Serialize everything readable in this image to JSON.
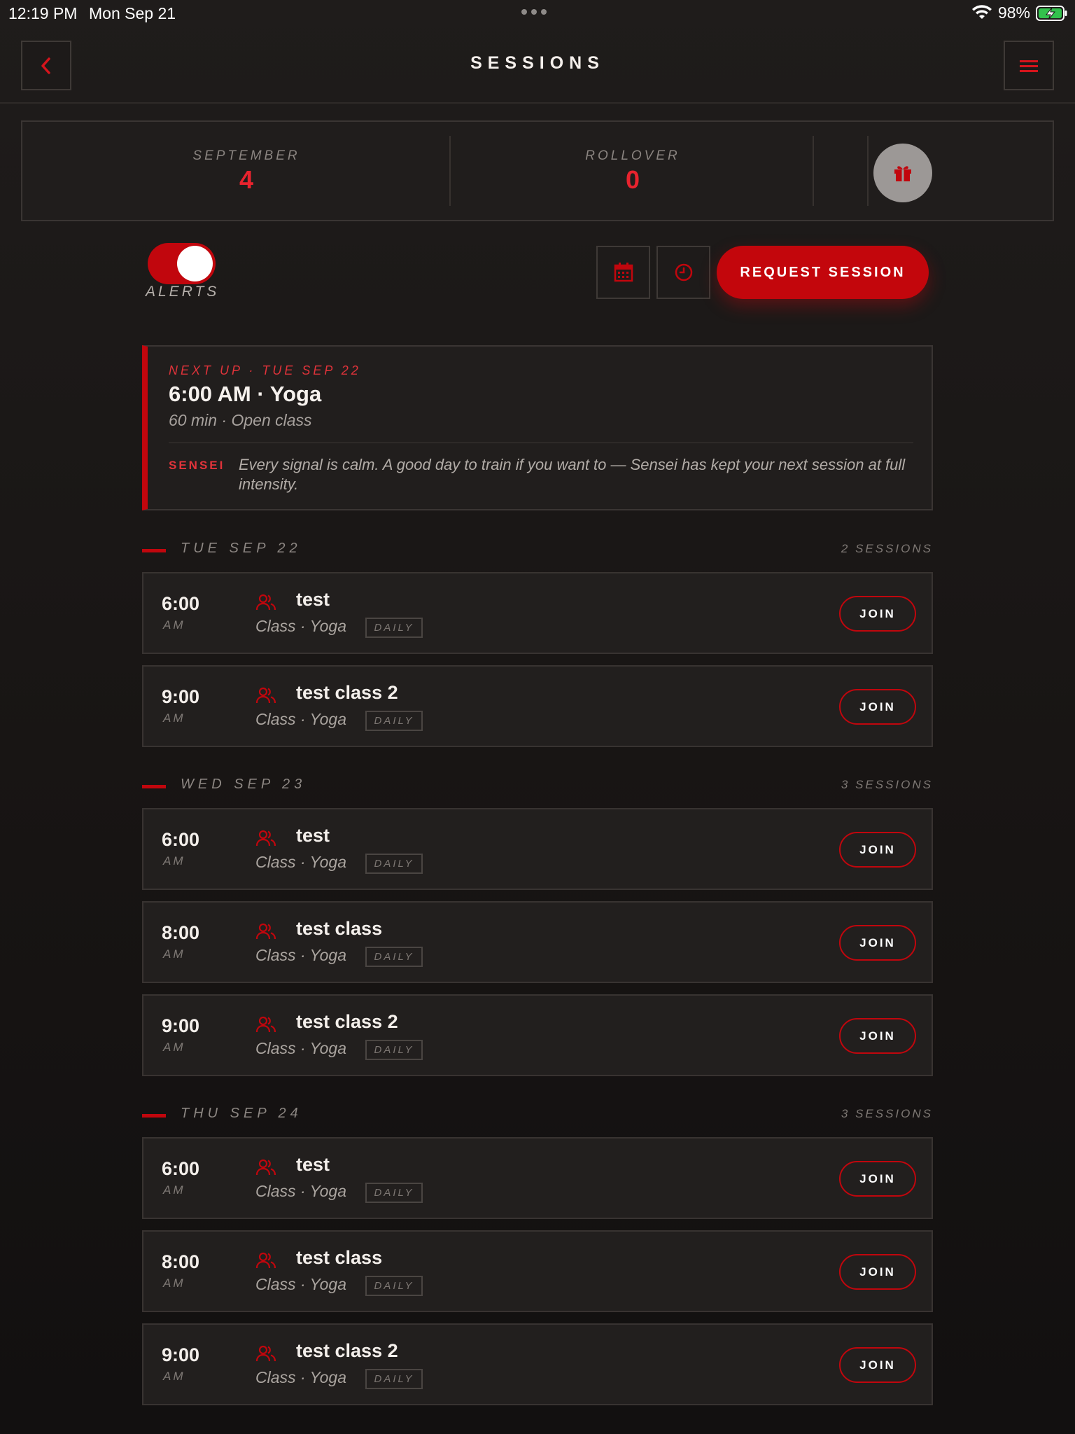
{
  "status_bar": {
    "time": "12:19 PM",
    "date": "Mon Sep 21",
    "battery": "98%"
  },
  "header": {
    "title": "SESSIONS",
    "back_icon": "chevron-left-icon",
    "menu_icon": "hamburger-menu-icon"
  },
  "stats": {
    "month_label": "SEPTEMBER",
    "month_value": "4",
    "rollover_label": "ROLLOVER",
    "rollover_value": "0",
    "gift_icon": "gift-icon"
  },
  "controls": {
    "alerts_label": "ALERTS",
    "alerts_on": true,
    "calendar_icon": "calendar-icon",
    "clock_icon": "clock-icon",
    "request_label": "REQUEST SESSION"
  },
  "next_up": {
    "eyebrow": "NEXT UP · TUE SEP 22",
    "title": "6:00 AM · Yoga",
    "subtitle": "60 min · Open class",
    "sensei_label": "SENSEI",
    "message": "Every signal is calm. A good day to train if you want to — Sensei has kept your next session at full intensity."
  },
  "days": [
    {
      "name": "TUE SEP 22",
      "count": "2 SESSIONS",
      "sessions": [
        {
          "time": "6:00",
          "ampm": "AM",
          "title": "test",
          "meta": "Class ·  Yoga",
          "badge": "DAILY",
          "join": "JOIN"
        },
        {
          "time": "9:00",
          "ampm": "AM",
          "title": "test class 2",
          "meta": "Class ·  Yoga",
          "badge": "DAILY",
          "join": "JOIN"
        }
      ]
    },
    {
      "name": "WED SEP 23",
      "count": "3 SESSIONS",
      "sessions": [
        {
          "time": "6:00",
          "ampm": "AM",
          "title": "test",
          "meta": "Class ·  Yoga",
          "badge": "DAILY",
          "join": "JOIN"
        },
        {
          "time": "8:00",
          "ampm": "AM",
          "title": "test class",
          "meta": "Class ·  Yoga",
          "badge": "DAILY",
          "join": "JOIN"
        },
        {
          "time": "9:00",
          "ampm": "AM",
          "title": "test class 2",
          "meta": "Class ·  Yoga",
          "badge": "DAILY",
          "join": "JOIN"
        }
      ]
    },
    {
      "name": "THU SEP 24",
      "count": "3 SESSIONS",
      "sessions": [
        {
          "time": "6:00",
          "ampm": "AM",
          "title": "test",
          "meta": "Class ·  Yoga",
          "badge": "DAILY",
          "join": "JOIN"
        },
        {
          "time": "8:00",
          "ampm": "AM",
          "title": "test class",
          "meta": "Class ·  Yoga",
          "badge": "DAILY",
          "join": "JOIN"
        },
        {
          "time": "9:00",
          "ampm": "AM",
          "title": "test class 2",
          "meta": "Class ·  Yoga",
          "badge": "DAILY",
          "join": "JOIN"
        }
      ]
    }
  ],
  "colors": {
    "accent": "#c1060d",
    "accent_text": "#e8232e",
    "background": "#1a1716"
  }
}
